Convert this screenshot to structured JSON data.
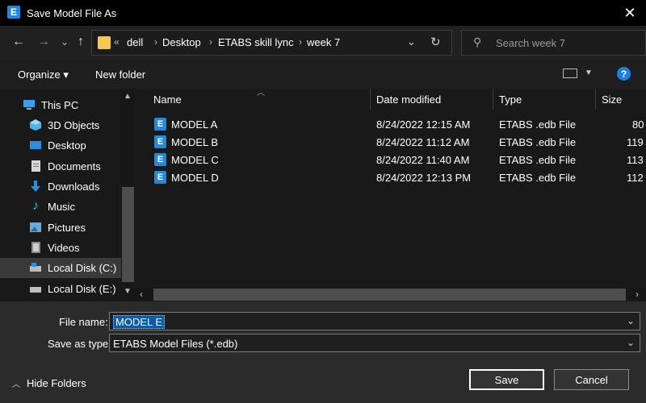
{
  "window": {
    "title": "Save Model File As",
    "app_icon_letter": "E",
    "close_glyph": "✕"
  },
  "nav": {
    "back": "←",
    "forward": "→",
    "recent": "⌄",
    "up": "↑",
    "address": {
      "overflow": "«",
      "segments": [
        "dell",
        "Desktop",
        "ETABS skill lync",
        "week 7"
      ],
      "separator": "›",
      "dropdown": "⌄",
      "refresh": "↻"
    },
    "search": {
      "placeholder": "Search week 7"
    }
  },
  "toolbar": {
    "organize": "Organize ▾",
    "new_folder": "New folder",
    "view_dropdown": "▼",
    "help": "?"
  },
  "sidebar": {
    "items": [
      {
        "label": "This PC",
        "icon": "pc-icon"
      },
      {
        "label": "3D Objects",
        "icon": "cube-icon"
      },
      {
        "label": "Desktop",
        "icon": "desktop-icon"
      },
      {
        "label": "Documents",
        "icon": "documents-icon"
      },
      {
        "label": "Downloads",
        "icon": "downloads-icon"
      },
      {
        "label": "Music",
        "icon": "music-icon"
      },
      {
        "label": "Pictures",
        "icon": "pictures-icon"
      },
      {
        "label": "Videos",
        "icon": "videos-icon"
      },
      {
        "label": "Local Disk (C:)",
        "icon": "drive-icon"
      },
      {
        "label": "Local Disk (E:)",
        "icon": "drive-icon"
      }
    ],
    "selected": "Local Disk (C:)"
  },
  "files": {
    "columns": {
      "name": "Name",
      "date": "Date modified",
      "type": "Type",
      "size": "Size"
    },
    "rows": [
      {
        "name": "MODEL A",
        "date": "8/24/2022 12:15 AM",
        "type": "ETABS .edb File",
        "size": "80"
      },
      {
        "name": "MODEL B",
        "date": "8/24/2022 11:12 AM",
        "type": "ETABS .edb File",
        "size": "119"
      },
      {
        "name": "MODEL C",
        "date": "8/24/2022 11:40 AM",
        "type": "ETABS .edb File",
        "size": "113"
      },
      {
        "name": "MODEL D",
        "date": "8/24/2022 12:13 PM",
        "type": "ETABS .edb File",
        "size": "112"
      }
    ]
  },
  "form": {
    "file_name_label": "File name:",
    "file_name_value": "MODEL E",
    "save_type_label": "Save as type:",
    "save_type_value": "ETABS Model Files (*.edb)"
  },
  "footer": {
    "hide_folders": "Hide Folders",
    "save": "Save",
    "cancel": "Cancel"
  },
  "colors": {
    "accent": "#1f8ae0",
    "selection": "#0e5aa6",
    "background": "#191919"
  }
}
